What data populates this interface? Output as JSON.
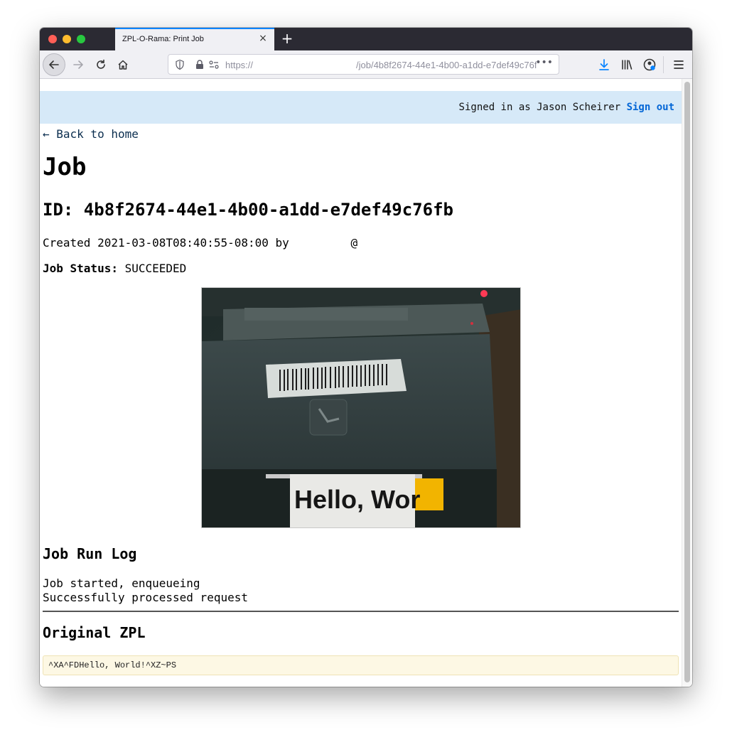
{
  "browser": {
    "tab_title": "ZPL-O-Rama: Print Job",
    "tab_close_glyph": "×",
    "new_tab_glyph": "+",
    "url_prefix": "https://",
    "url_path": "/job/4b8f2674-44e1-4b00-a1dd-e7def49c76fb",
    "url_more_glyph": "•••",
    "accent": "#0a84ff"
  },
  "header": {
    "signed_in_text": "Signed in as Jason Scheirer ",
    "sign_out_label": "Sign out",
    "bar_color": "#d6e9f8"
  },
  "nav": {
    "back_link": "← Back to home"
  },
  "job": {
    "title": "Job",
    "id_line": "ID: 4b8f2674-44e1-4b00-a1dd-e7def49c76fb",
    "created_line": "Created 2021-03-08T08:40:55-08:00 by         @",
    "status_label": "Job Status:",
    "status_value": "SUCCEEDED"
  },
  "photo": {
    "label_text": "Hello, Wor"
  },
  "log": {
    "heading": "Job Run Log",
    "lines": [
      "Job started, enqueueing",
      "Successfully processed request"
    ]
  },
  "zpl": {
    "heading": "Original ZPL",
    "code": "^XA^FDHello, World!^XZ~PS"
  }
}
